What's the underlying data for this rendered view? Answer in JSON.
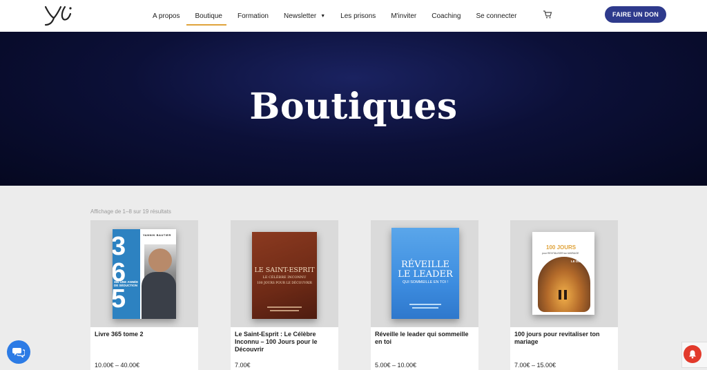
{
  "header": {
    "nav": [
      {
        "label": "A propos"
      },
      {
        "label": "Boutique"
      },
      {
        "label": "Formation"
      },
      {
        "label": "Newsletter"
      },
      {
        "label": "Les prisons"
      },
      {
        "label": "M'inviter"
      },
      {
        "label": "Coaching"
      },
      {
        "label": "Se connecter"
      }
    ],
    "donate_label": "FAIRE UN DON",
    "icons": {
      "cart": "cart-icon",
      "logo": "logo-mark"
    }
  },
  "hero": {
    "title": "Boutiques"
  },
  "shop": {
    "result_count": "Affichage de 1–8 sur 19 résultats",
    "products": [
      {
        "title": "Livre 365 tome 2",
        "price": "10.00€ – 40.00€"
      },
      {
        "title": "Le Saint-Esprit : Le Célèbre Inconnu – 100 Jours pour le Découvrir",
        "price": "7.00€"
      },
      {
        "title": "Réveille le leader qui sommeille en toi",
        "price": "5.00€ – 10.00€"
      },
      {
        "title": "100 jours pour revitaliser ton mariage",
        "price": "7.00€ – 15.00€"
      }
    ],
    "covers": {
      "book1": {
        "big": "365",
        "author": "YANNIK BAUTIER",
        "sub": "365 UNE ANNÉE DE SÉDUCTION"
      },
      "book2": {
        "title": "LE SAINT-ESPRIT",
        "sub": "LE CÉLÈBRE INCONNU",
        "sub2": "100 JOURS POUR LE DÉCOUVRIR"
      },
      "book3": {
        "title1": "RÉVEILLE",
        "title2": "LE LEADER",
        "sub": "QUI SOMMEILLE EN TOI !"
      },
      "book4": {
        "title1": "100 JOURS",
        "sub": "pour REVITALISER ton MARIAGE",
        "tag": "LE DÉFI"
      }
    }
  },
  "colors": {
    "accent": "#e0a33a",
    "donate": "#2e3a8c",
    "hero": "#0c1038"
  }
}
